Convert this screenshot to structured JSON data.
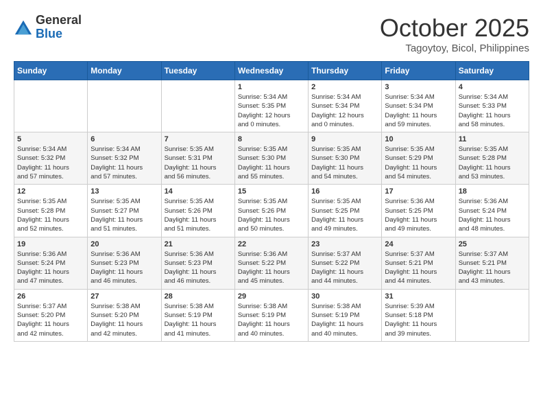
{
  "logo": {
    "general": "General",
    "blue": "Blue"
  },
  "title": "October 2025",
  "location": "Tagoytoy, Bicol, Philippines",
  "weekdays": [
    "Sunday",
    "Monday",
    "Tuesday",
    "Wednesday",
    "Thursday",
    "Friday",
    "Saturday"
  ],
  "weeks": [
    [
      {
        "day": "",
        "info": ""
      },
      {
        "day": "",
        "info": ""
      },
      {
        "day": "",
        "info": ""
      },
      {
        "day": "1",
        "info": "Sunrise: 5:34 AM\nSunset: 5:35 PM\nDaylight: 12 hours\nand 0 minutes."
      },
      {
        "day": "2",
        "info": "Sunrise: 5:34 AM\nSunset: 5:34 PM\nDaylight: 12 hours\nand 0 minutes."
      },
      {
        "day": "3",
        "info": "Sunrise: 5:34 AM\nSunset: 5:34 PM\nDaylight: 11 hours\nand 59 minutes."
      },
      {
        "day": "4",
        "info": "Sunrise: 5:34 AM\nSunset: 5:33 PM\nDaylight: 11 hours\nand 58 minutes."
      }
    ],
    [
      {
        "day": "5",
        "info": "Sunrise: 5:34 AM\nSunset: 5:32 PM\nDaylight: 11 hours\nand 57 minutes."
      },
      {
        "day": "6",
        "info": "Sunrise: 5:34 AM\nSunset: 5:32 PM\nDaylight: 11 hours\nand 57 minutes."
      },
      {
        "day": "7",
        "info": "Sunrise: 5:35 AM\nSunset: 5:31 PM\nDaylight: 11 hours\nand 56 minutes."
      },
      {
        "day": "8",
        "info": "Sunrise: 5:35 AM\nSunset: 5:30 PM\nDaylight: 11 hours\nand 55 minutes."
      },
      {
        "day": "9",
        "info": "Sunrise: 5:35 AM\nSunset: 5:30 PM\nDaylight: 11 hours\nand 54 minutes."
      },
      {
        "day": "10",
        "info": "Sunrise: 5:35 AM\nSunset: 5:29 PM\nDaylight: 11 hours\nand 54 minutes."
      },
      {
        "day": "11",
        "info": "Sunrise: 5:35 AM\nSunset: 5:28 PM\nDaylight: 11 hours\nand 53 minutes."
      }
    ],
    [
      {
        "day": "12",
        "info": "Sunrise: 5:35 AM\nSunset: 5:28 PM\nDaylight: 11 hours\nand 52 minutes."
      },
      {
        "day": "13",
        "info": "Sunrise: 5:35 AM\nSunset: 5:27 PM\nDaylight: 11 hours\nand 51 minutes."
      },
      {
        "day": "14",
        "info": "Sunrise: 5:35 AM\nSunset: 5:26 PM\nDaylight: 11 hours\nand 51 minutes."
      },
      {
        "day": "15",
        "info": "Sunrise: 5:35 AM\nSunset: 5:26 PM\nDaylight: 11 hours\nand 50 minutes."
      },
      {
        "day": "16",
        "info": "Sunrise: 5:35 AM\nSunset: 5:25 PM\nDaylight: 11 hours\nand 49 minutes."
      },
      {
        "day": "17",
        "info": "Sunrise: 5:36 AM\nSunset: 5:25 PM\nDaylight: 11 hours\nand 49 minutes."
      },
      {
        "day": "18",
        "info": "Sunrise: 5:36 AM\nSunset: 5:24 PM\nDaylight: 11 hours\nand 48 minutes."
      }
    ],
    [
      {
        "day": "19",
        "info": "Sunrise: 5:36 AM\nSunset: 5:24 PM\nDaylight: 11 hours\nand 47 minutes."
      },
      {
        "day": "20",
        "info": "Sunrise: 5:36 AM\nSunset: 5:23 PM\nDaylight: 11 hours\nand 46 minutes."
      },
      {
        "day": "21",
        "info": "Sunrise: 5:36 AM\nSunset: 5:23 PM\nDaylight: 11 hours\nand 46 minutes."
      },
      {
        "day": "22",
        "info": "Sunrise: 5:36 AM\nSunset: 5:22 PM\nDaylight: 11 hours\nand 45 minutes."
      },
      {
        "day": "23",
        "info": "Sunrise: 5:37 AM\nSunset: 5:22 PM\nDaylight: 11 hours\nand 44 minutes."
      },
      {
        "day": "24",
        "info": "Sunrise: 5:37 AM\nSunset: 5:21 PM\nDaylight: 11 hours\nand 44 minutes."
      },
      {
        "day": "25",
        "info": "Sunrise: 5:37 AM\nSunset: 5:21 PM\nDaylight: 11 hours\nand 43 minutes."
      }
    ],
    [
      {
        "day": "26",
        "info": "Sunrise: 5:37 AM\nSunset: 5:20 PM\nDaylight: 11 hours\nand 42 minutes."
      },
      {
        "day": "27",
        "info": "Sunrise: 5:38 AM\nSunset: 5:20 PM\nDaylight: 11 hours\nand 42 minutes."
      },
      {
        "day": "28",
        "info": "Sunrise: 5:38 AM\nSunset: 5:19 PM\nDaylight: 11 hours\nand 41 minutes."
      },
      {
        "day": "29",
        "info": "Sunrise: 5:38 AM\nSunset: 5:19 PM\nDaylight: 11 hours\nand 40 minutes."
      },
      {
        "day": "30",
        "info": "Sunrise: 5:38 AM\nSunset: 5:19 PM\nDaylight: 11 hours\nand 40 minutes."
      },
      {
        "day": "31",
        "info": "Sunrise: 5:39 AM\nSunset: 5:18 PM\nDaylight: 11 hours\nand 39 minutes."
      },
      {
        "day": "",
        "info": ""
      }
    ]
  ]
}
